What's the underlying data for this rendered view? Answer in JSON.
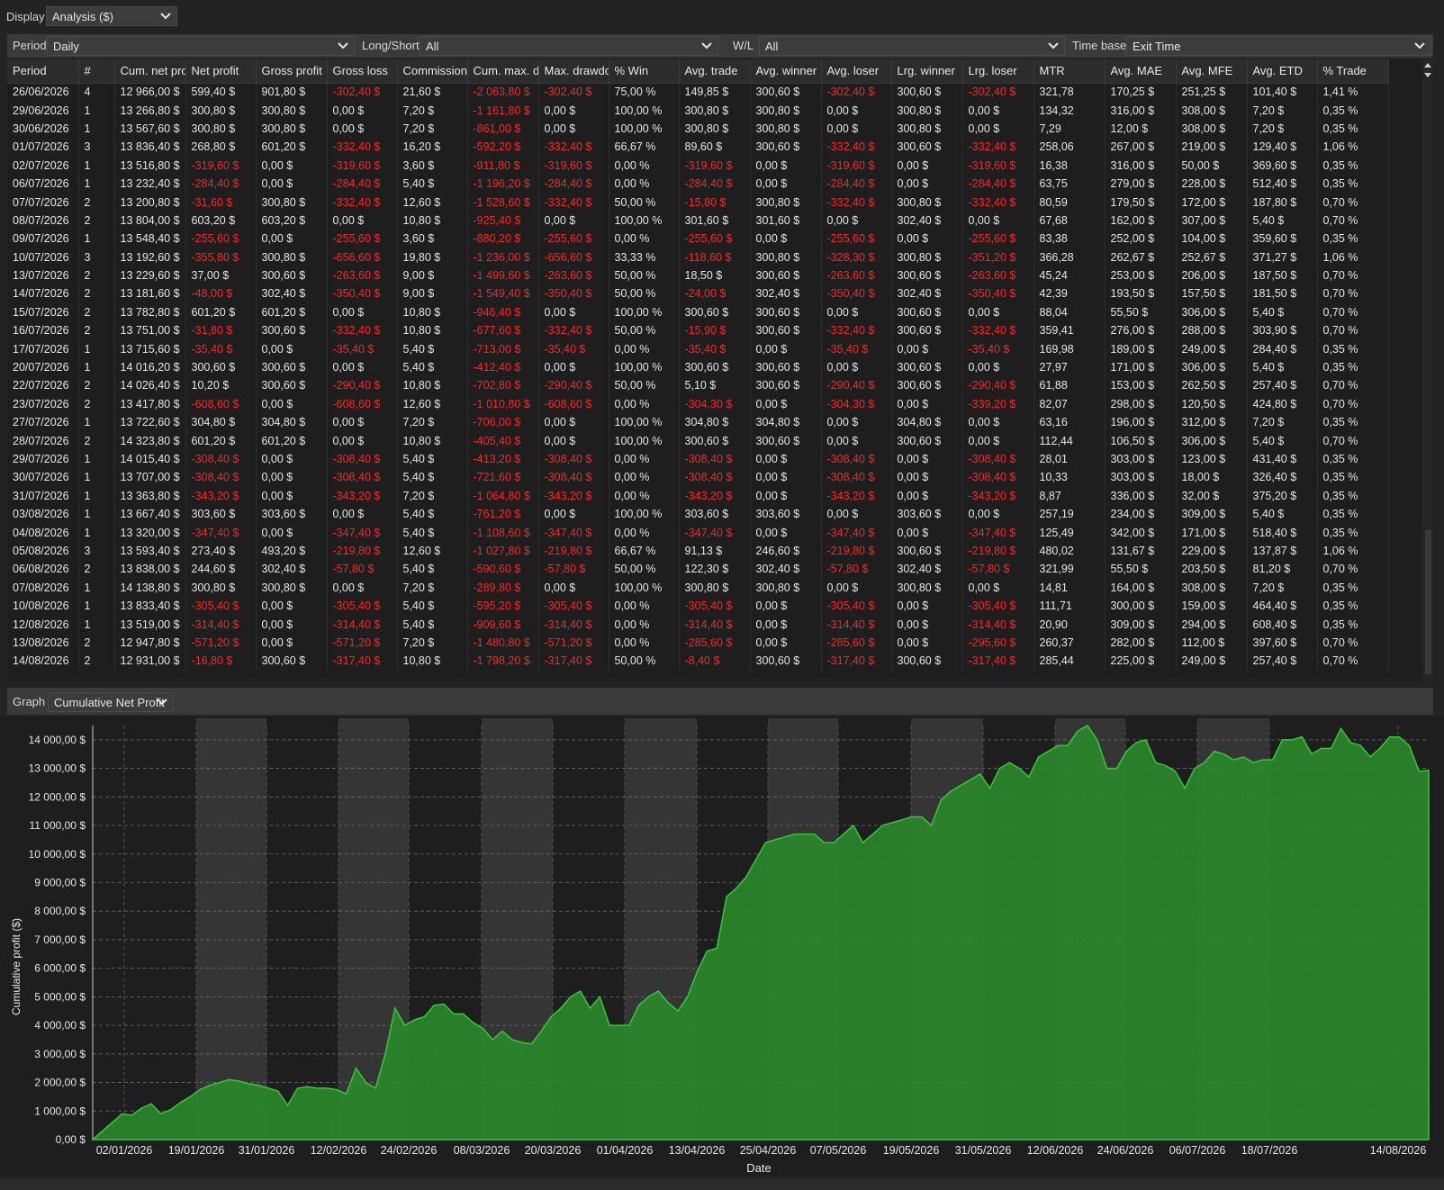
{
  "display": {
    "label": "Display",
    "value": "Analysis ($)"
  },
  "filters": {
    "period": {
      "label": "Period",
      "value": "Daily"
    },
    "long_short": {
      "label": "Long/Short",
      "value": "All"
    },
    "wl": {
      "label": "W/L",
      "value": "All"
    },
    "time_base": {
      "label": "Time base",
      "value": "Exit Time"
    }
  },
  "table": {
    "columns": [
      "Period",
      "#",
      "Cum. net pro",
      "Net profit",
      "Gross profit",
      "Gross loss",
      "Commission",
      "Cum. max. d",
      "Max. drawdo",
      "% Win",
      "Avg. trade",
      "Avg. winner",
      "Avg. loser",
      "Lrg. winner",
      "Lrg. loser",
      "MTR",
      "Avg. MAE",
      "Avg. MFE",
      "Avg. ETD",
      "% Trade"
    ],
    "rows": [
      [
        "26/06/2026",
        "4",
        "12 966,00 $",
        "599,40 $",
        "901,80 $",
        "-302,40 $",
        "21,60 $",
        "-2 063,80 $",
        "-302,40 $",
        "75,00 %",
        "149,85 $",
        "300,60 $",
        "-302,40 $",
        "300,60 $",
        "-302,40 $",
        "321,78",
        "170,25 $",
        "251,25 $",
        "101,40 $",
        "1,41 %"
      ],
      [
        "29/06/2026",
        "1",
        "13 266,80 $",
        "300,80 $",
        "300,80 $",
        "0,00 $",
        "7,20 $",
        "-1 161,80 $",
        "0,00 $",
        "100,00 %",
        "300,80 $",
        "300,80 $",
        "0,00 $",
        "300,80 $",
        "0,00 $",
        "134,32",
        "316,00 $",
        "308,00 $",
        "7,20 $",
        "0,35 %"
      ],
      [
        "30/06/2026",
        "1",
        "13 567,60 $",
        "300,80 $",
        "300,80 $",
        "0,00 $",
        "7,20 $",
        "-861,00 $",
        "0,00 $",
        "100,00 %",
        "300,80 $",
        "300,80 $",
        "0,00 $",
        "300,80 $",
        "0,00 $",
        "7,29",
        "12,00 $",
        "308,00 $",
        "7,20 $",
        "0,35 %"
      ],
      [
        "01/07/2026",
        "3",
        "13 836,40 $",
        "268,80 $",
        "601,20 $",
        "-332,40 $",
        "16,20 $",
        "-592,20 $",
        "-332,40 $",
        "66,67 %",
        "89,60 $",
        "300,60 $",
        "-332,40 $",
        "300,60 $",
        "-332,40 $",
        "258,06",
        "267,00 $",
        "219,00 $",
        "129,40 $",
        "1,06 %"
      ],
      [
        "02/07/2026",
        "1",
        "13 516,80 $",
        "-319,60 $",
        "0,00 $",
        "-319,60 $",
        "3,60 $",
        "-911,80 $",
        "-319,60 $",
        "0,00 %",
        "-319,60 $",
        "0,00 $",
        "-319,60 $",
        "0,00 $",
        "-319,60 $",
        "16,38",
        "316,00 $",
        "50,00 $",
        "369,60 $",
        "0,35 %"
      ],
      [
        "06/07/2026",
        "1",
        "13 232,40 $",
        "-284,40 $",
        "0,00 $",
        "-284,40 $",
        "5,40 $",
        "-1 196,20 $",
        "-284,40 $",
        "0,00 %",
        "-284,40 $",
        "0,00 $",
        "-284,40 $",
        "0,00 $",
        "-284,40 $",
        "63,75",
        "279,00 $",
        "228,00 $",
        "512,40 $",
        "0,35 %"
      ],
      [
        "07/07/2026",
        "2",
        "13 200,80 $",
        "-31,60 $",
        "300,80 $",
        "-332,40 $",
        "12,60 $",
        "-1 528,60 $",
        "-332,40 $",
        "50,00 %",
        "-15,80 $",
        "300,80 $",
        "-332,40 $",
        "300,80 $",
        "-332,40 $",
        "80,59",
        "179,50 $",
        "172,00 $",
        "187,80 $",
        "0,70 %"
      ],
      [
        "08/07/2026",
        "2",
        "13 804,00 $",
        "603,20 $",
        "603,20 $",
        "0,00 $",
        "10,80 $",
        "-925,40 $",
        "0,00 $",
        "100,00 %",
        "301,60 $",
        "301,60 $",
        "0,00 $",
        "302,40 $",
        "0,00 $",
        "67,68",
        "162,00 $",
        "307,00 $",
        "5,40 $",
        "0,70 %"
      ],
      [
        "09/07/2026",
        "1",
        "13 548,40 $",
        "-255,60 $",
        "0,00 $",
        "-255,60 $",
        "3,60 $",
        "-880,20 $",
        "-255,60 $",
        "0,00 %",
        "-255,60 $",
        "0,00 $",
        "-255,60 $",
        "0,00 $",
        "-255,60 $",
        "83,38",
        "252,00 $",
        "104,00 $",
        "359,60 $",
        "0,35 %"
      ],
      [
        "10/07/2026",
        "3",
        "13 192,60 $",
        "-355,80 $",
        "300,80 $",
        "-656,60 $",
        "19,80 $",
        "-1 236,00 $",
        "-656,60 $",
        "33,33 %",
        "-118,60 $",
        "300,80 $",
        "-328,30 $",
        "300,80 $",
        "-351,20 $",
        "366,28",
        "262,67 $",
        "252,67 $",
        "371,27 $",
        "1,06 %"
      ],
      [
        "13/07/2026",
        "2",
        "13 229,60 $",
        "37,00 $",
        "300,60 $",
        "-263,60 $",
        "9,00 $",
        "-1 499,60 $",
        "-263,60 $",
        "50,00 %",
        "18,50 $",
        "300,60 $",
        "-263,60 $",
        "300,60 $",
        "-263,60 $",
        "45,24",
        "253,00 $",
        "206,00 $",
        "187,50 $",
        "0,70 %"
      ],
      [
        "14/07/2026",
        "2",
        "13 181,60 $",
        "-48,00 $",
        "302,40 $",
        "-350,40 $",
        "9,00 $",
        "-1 549,40 $",
        "-350,40 $",
        "50,00 %",
        "-24,00 $",
        "302,40 $",
        "-350,40 $",
        "302,40 $",
        "-350,40 $",
        "42,39",
        "193,50 $",
        "157,50 $",
        "181,50 $",
        "0,70 %"
      ],
      [
        "15/07/2026",
        "2",
        "13 782,80 $",
        "601,20 $",
        "601,20 $",
        "0,00 $",
        "10,80 $",
        "-946,40 $",
        "0,00 $",
        "100,00 %",
        "300,60 $",
        "300,60 $",
        "0,00 $",
        "300,60 $",
        "0,00 $",
        "88,04",
        "55,50 $",
        "306,00 $",
        "5,40 $",
        "0,70 %"
      ],
      [
        "16/07/2026",
        "2",
        "13 751,00 $",
        "-31,80 $",
        "300,60 $",
        "-332,40 $",
        "10,80 $",
        "-677,60 $",
        "-332,40 $",
        "50,00 %",
        "-15,90 $",
        "300,60 $",
        "-332,40 $",
        "300,60 $",
        "-332,40 $",
        "359,41",
        "276,00 $",
        "288,00 $",
        "303,90 $",
        "0,70 %"
      ],
      [
        "17/07/2026",
        "1",
        "13 715,60 $",
        "-35,40 $",
        "0,00 $",
        "-35,40 $",
        "5,40 $",
        "-713,00 $",
        "-35,40 $",
        "0,00 %",
        "-35,40 $",
        "0,00 $",
        "-35,40 $",
        "0,00 $",
        "-35,40 $",
        "169,98",
        "189,00 $",
        "249,00 $",
        "284,40 $",
        "0,35 %"
      ],
      [
        "20/07/2026",
        "1",
        "14 016,20 $",
        "300,60 $",
        "300,60 $",
        "0,00 $",
        "5,40 $",
        "-412,40 $",
        "0,00 $",
        "100,00 %",
        "300,60 $",
        "300,60 $",
        "0,00 $",
        "300,60 $",
        "0,00 $",
        "27,97",
        "171,00 $",
        "306,00 $",
        "5,40 $",
        "0,35 %"
      ],
      [
        "22/07/2026",
        "2",
        "14 026,40 $",
        "10,20 $",
        "300,60 $",
        "-290,40 $",
        "10,80 $",
        "-702,80 $",
        "-290,40 $",
        "50,00 %",
        "5,10 $",
        "300,60 $",
        "-290,40 $",
        "300,60 $",
        "-290,40 $",
        "61,88",
        "153,00 $",
        "262,50 $",
        "257,40 $",
        "0,70 %"
      ],
      [
        "23/07/2026",
        "2",
        "13 417,80 $",
        "-608,60 $",
        "0,00 $",
        "-608,60 $",
        "12,60 $",
        "-1 010,80 $",
        "-608,60 $",
        "0,00 %",
        "-304,30 $",
        "0,00 $",
        "-304,30 $",
        "0,00 $",
        "-339,20 $",
        "82,07",
        "298,00 $",
        "120,50 $",
        "424,80 $",
        "0,70 %"
      ],
      [
        "27/07/2026",
        "1",
        "13 722,60 $",
        "304,80 $",
        "304,80 $",
        "0,00 $",
        "7,20 $",
        "-706,00 $",
        "0,00 $",
        "100,00 %",
        "304,80 $",
        "304,80 $",
        "0,00 $",
        "304,80 $",
        "0,00 $",
        "63,16",
        "196,00 $",
        "312,00 $",
        "7,20 $",
        "0,35 %"
      ],
      [
        "28/07/2026",
        "2",
        "14 323,80 $",
        "601,20 $",
        "601,20 $",
        "0,00 $",
        "10,80 $",
        "-405,40 $",
        "0,00 $",
        "100,00 %",
        "300,60 $",
        "300,60 $",
        "0,00 $",
        "300,60 $",
        "0,00 $",
        "112,44",
        "106,50 $",
        "306,00 $",
        "5,40 $",
        "0,70 %"
      ],
      [
        "29/07/2026",
        "1",
        "14 015,40 $",
        "-308,40 $",
        "0,00 $",
        "-308,40 $",
        "5,40 $",
        "-413,20 $",
        "-308,40 $",
        "0,00 %",
        "-308,40 $",
        "0,00 $",
        "-308,40 $",
        "0,00 $",
        "-308,40 $",
        "28,01",
        "303,00 $",
        "123,00 $",
        "431,40 $",
        "0,35 %"
      ],
      [
        "30/07/2026",
        "1",
        "13 707,00 $",
        "-308,40 $",
        "0,00 $",
        "-308,40 $",
        "5,40 $",
        "-721,60 $",
        "-308,40 $",
        "0,00 %",
        "-308,40 $",
        "0,00 $",
        "-308,40 $",
        "0,00 $",
        "-308,40 $",
        "10,33",
        "303,00 $",
        "18,00 $",
        "326,40 $",
        "0,35 %"
      ],
      [
        "31/07/2026",
        "1",
        "13 363,80 $",
        "-343,20 $",
        "0,00 $",
        "-343,20 $",
        "7,20 $",
        "-1 064,80 $",
        "-343,20 $",
        "0,00 %",
        "-343,20 $",
        "0,00 $",
        "-343,20 $",
        "0,00 $",
        "-343,20 $",
        "8,87",
        "336,00 $",
        "32,00 $",
        "375,20 $",
        "0,35 %"
      ],
      [
        "03/08/2026",
        "1",
        "13 667,40 $",
        "303,60 $",
        "303,60 $",
        "0,00 $",
        "5,40 $",
        "-761,20 $",
        "0,00 $",
        "100,00 %",
        "303,60 $",
        "303,60 $",
        "0,00 $",
        "303,60 $",
        "0,00 $",
        "257,19",
        "234,00 $",
        "309,00 $",
        "5,40 $",
        "0,35 %"
      ],
      [
        "04/08/2026",
        "1",
        "13 320,00 $",
        "-347,40 $",
        "0,00 $",
        "-347,40 $",
        "5,40 $",
        "-1 108,60 $",
        "-347,40 $",
        "0,00 %",
        "-347,40 $",
        "0,00 $",
        "-347,40 $",
        "0,00 $",
        "-347,40 $",
        "125,49",
        "342,00 $",
        "171,00 $",
        "518,40 $",
        "0,35 %"
      ],
      [
        "05/08/2026",
        "3",
        "13 593,40 $",
        "273,40 $",
        "493,20 $",
        "-219,80 $",
        "12,60 $",
        "-1 027,80 $",
        "-219,80 $",
        "66,67 %",
        "91,13 $",
        "246,60 $",
        "-219,80 $",
        "300,60 $",
        "-219,80 $",
        "480,02",
        "131,67 $",
        "229,00 $",
        "137,87 $",
        "1,06 %"
      ],
      [
        "06/08/2026",
        "2",
        "13 838,00 $",
        "244,60 $",
        "302,40 $",
        "-57,80 $",
        "5,40 $",
        "-590,60 $",
        "-57,80 $",
        "50,00 %",
        "122,30 $",
        "302,40 $",
        "-57,80 $",
        "302,40 $",
        "-57,80 $",
        "321,99",
        "55,50 $",
        "203,50 $",
        "81,20 $",
        "0,70 %"
      ],
      [
        "07/08/2026",
        "1",
        "14 138,80 $",
        "300,80 $",
        "300,80 $",
        "0,00 $",
        "7,20 $",
        "-289,80 $",
        "0,00 $",
        "100,00 %",
        "300,80 $",
        "300,80 $",
        "0,00 $",
        "300,80 $",
        "0,00 $",
        "14,81",
        "164,00 $",
        "308,00 $",
        "7,20 $",
        "0,35 %"
      ],
      [
        "10/08/2026",
        "1",
        "13 833,40 $",
        "-305,40 $",
        "0,00 $",
        "-305,40 $",
        "5,40 $",
        "-595,20 $",
        "-305,40 $",
        "0,00 %",
        "-305,40 $",
        "0,00 $",
        "-305,40 $",
        "0,00 $",
        "-305,40 $",
        "111,71",
        "300,00 $",
        "159,00 $",
        "464,40 $",
        "0,35 %"
      ],
      [
        "12/08/2026",
        "1",
        "13 519,00 $",
        "-314,40 $",
        "0,00 $",
        "-314,40 $",
        "5,40 $",
        "-909,60 $",
        "-314,40 $",
        "0,00 %",
        "-314,40 $",
        "0,00 $",
        "-314,40 $",
        "0,00 $",
        "-314,40 $",
        "20,90",
        "309,00 $",
        "294,00 $",
        "608,40 $",
        "0,35 %"
      ],
      [
        "13/08/2026",
        "2",
        "12 947,80 $",
        "-571,20 $",
        "0,00 $",
        "-571,20 $",
        "7,20 $",
        "-1 480,80 $",
        "-571,20 $",
        "0,00 %",
        "-285,60 $",
        "0,00 $",
        "-285,60 $",
        "0,00 $",
        "-295,60 $",
        "260,37",
        "282,00 $",
        "112,00 $",
        "397,60 $",
        "0,70 %"
      ],
      [
        "14/08/2026",
        "2",
        "12 931,00 $",
        "-16,80 $",
        "300,60 $",
        "-317,40 $",
        "10,80 $",
        "-1 798,20 $",
        "-317,40 $",
        "50,00 %",
        "-8,40 $",
        "300,60 $",
        "-317,40 $",
        "300,60 $",
        "-317,40 $",
        "285,44",
        "225,00 $",
        "249,00 $",
        "257,40 $",
        "0,70 %"
      ]
    ]
  },
  "graph": {
    "label": "Graph",
    "value": "Cumulative Net Profit"
  },
  "colors": {
    "area_fill": "#2a8a2a",
    "area_line": "#3cc43c",
    "negative_text": "#ff2222",
    "panel": "#3a3a3a"
  },
  "chart_data": {
    "type": "area",
    "xlabel": "Date",
    "ylabel": "Cumulative profit ($)",
    "ylim": [
      0,
      14500
    ],
    "ytick_labels": [
      "0,00 $",
      "1 000,00 $",
      "2 000,00 $",
      "3 000,00 $",
      "4 000,00 $",
      "5 000,00 $",
      "6 000,00 $",
      "7 000,00 $",
      "8 000,00 $",
      "9 000,00 $",
      "10 000,00 $",
      "11 000,00 $",
      "12 000,00 $",
      "13 000,00 $",
      "14 000,00 $"
    ],
    "xtick_labels": [
      "02/01/2026",
      "19/01/2026",
      "31/01/2026",
      "12/02/2026",
      "24/02/2026",
      "08/03/2026",
      "20/03/2026",
      "01/04/2026",
      "13/04/2026",
      "25/04/2026",
      "07/05/2026",
      "19/05/2026",
      "31/05/2026",
      "12/06/2026",
      "24/06/2026",
      "06/07/2026",
      "18/07/2026",
      "14/08/2026"
    ],
    "grid": true,
    "series": [
      {
        "values": [
          0,
          300,
          600,
          900,
          850,
          1100,
          1250,
          900,
          1050,
          1300,
          1500,
          1750,
          1900,
          2000,
          2100,
          2050,
          1950,
          1900,
          1800,
          1700,
          1200,
          1800,
          1850,
          1800,
          1800,
          1750,
          1600,
          2500,
          2000,
          1800,
          3000,
          4600,
          4000,
          4200,
          4300,
          4700,
          4750,
          4400,
          4400,
          4100,
          3900,
          3500,
          3800,
          3500,
          3400,
          3350,
          3800,
          4300,
          4600,
          5000,
          5200,
          4600,
          5000,
          4000,
          4000,
          4000,
          4700,
          5000,
          5200,
          4800,
          4500,
          5000,
          5900,
          6600,
          6700,
          8500,
          8800,
          9200,
          9800,
          10400,
          10500,
          10600,
          10700,
          10700,
          10700,
          10400,
          10400,
          10700,
          11000,
          10400,
          10700,
          11000,
          11100,
          11200,
          11300,
          11300,
          11000,
          11900,
          12200,
          12400,
          12600,
          12800,
          12300,
          13000,
          13200,
          13000,
          12700,
          13400,
          13600,
          13800,
          13800,
          14300,
          14500,
          14000,
          13000,
          13000,
          13600,
          13900,
          14000,
          13200,
          13100,
          12900,
          12300,
          13000,
          13200,
          13600,
          13500,
          13300,
          13400,
          13200,
          13300,
          13300,
          14000,
          14000,
          14100,
          13500,
          13700,
          13700,
          14400,
          13900,
          13800,
          13400,
          13700,
          14100,
          14100,
          13800,
          12900,
          12930
        ]
      }
    ]
  }
}
